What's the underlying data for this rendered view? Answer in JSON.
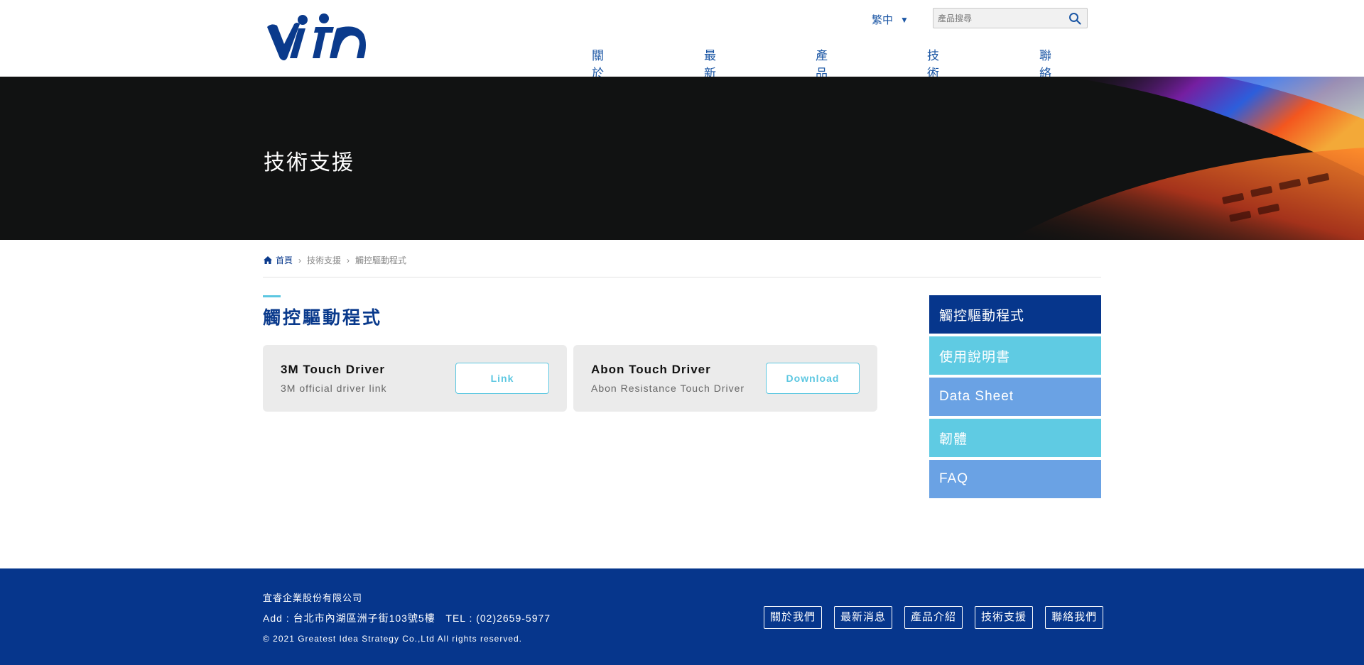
{
  "brand": {
    "logo_text": "vita",
    "logo_color": "#0a3a8c"
  },
  "header": {
    "language": "繁中",
    "language_caret": "▼",
    "search_placeholder": "產品搜尋",
    "search_icon": "search-icon",
    "nav": [
      {
        "label": "關於我們"
      },
      {
        "label": "最新消息"
      },
      {
        "label": "產品介紹"
      },
      {
        "label": "技術支援"
      },
      {
        "label": "聯絡我們"
      }
    ]
  },
  "hero": {
    "title": "技術支援"
  },
  "breadcrumb": {
    "home_icon": "home-icon",
    "home": "首頁",
    "sep": "›",
    "items": [
      "技術支援",
      "觸控驅動程式"
    ]
  },
  "main": {
    "title": "觸控驅動程式",
    "cards": [
      {
        "title": "3M Touch Driver",
        "desc": "3M official driver link",
        "button": "Link"
      },
      {
        "title": "Abon Touch Driver",
        "desc": "Abon Resistance Touch Driver",
        "button": "Download"
      }
    ]
  },
  "sidebar": {
    "items": [
      {
        "label": "觸控驅動程式",
        "state": "active"
      },
      {
        "label": "使用說明書",
        "state": "cyan"
      },
      {
        "label": "Data Sheet",
        "state": "blue"
      },
      {
        "label": "韌體",
        "state": "cyan"
      },
      {
        "label": "FAQ",
        "state": "blue"
      }
    ]
  },
  "footer": {
    "company": "宜睿企業股份有限公司",
    "address": "Add : 台北市內湖區洲子街103號5樓   TEL : (02)2659-5977",
    "copyright": "© 2021 Greatest Idea Strategy Co.,Ltd All rights reserved.",
    "links": [
      "關於我們",
      "最新消息",
      "產品介紹",
      "技術支援",
      "聯絡我們"
    ]
  },
  "colors": {
    "primary": "#06368c",
    "accent_cyan": "#5fcbe3",
    "accent_blue": "#6aa2e4",
    "nav_text": "#1c57a5"
  }
}
